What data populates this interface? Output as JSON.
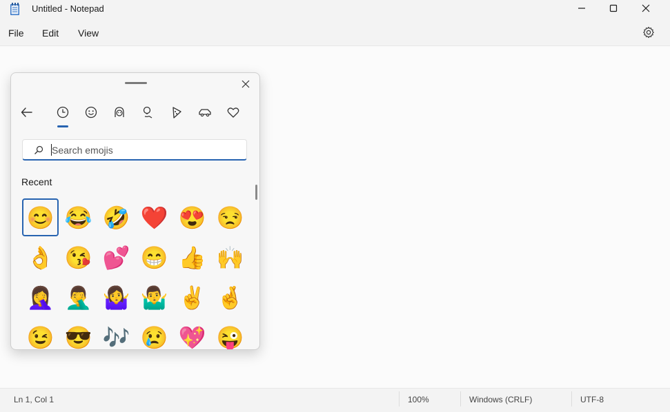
{
  "window": {
    "title": "Untitled - Notepad"
  },
  "menu": {
    "file": "File",
    "edit": "Edit",
    "view": "View"
  },
  "emoji_panel": {
    "search": {
      "placeholder": "Search emojis",
      "value": ""
    },
    "section_label": "Recent",
    "tabs": [
      "back-arrow-icon",
      "recent-clock-icon",
      "smiley-icon",
      "people-icon",
      "places-icon",
      "food-icon",
      "car-icon",
      "heart-icon"
    ],
    "selected_tab": "recent-clock-icon",
    "emojis": [
      [
        "😊",
        "😂",
        "🤣",
        "❤️",
        "😍",
        "😒"
      ],
      [
        "👌",
        "😘",
        "💕",
        "😁",
        "👍",
        "🙌"
      ],
      [
        "🤦‍♀️",
        "🤦‍♂️",
        "🤷‍♀️",
        "🤷‍♂️",
        "✌️",
        "🤞"
      ],
      [
        "😉",
        "😎",
        "🎶",
        "😢",
        "💖",
        "😜"
      ]
    ],
    "selected_emoji": "😊"
  },
  "status": {
    "position": "Ln 1, Col 1",
    "zoom": "100%",
    "line_ending": "Windows (CRLF)",
    "encoding": "UTF-8"
  }
}
